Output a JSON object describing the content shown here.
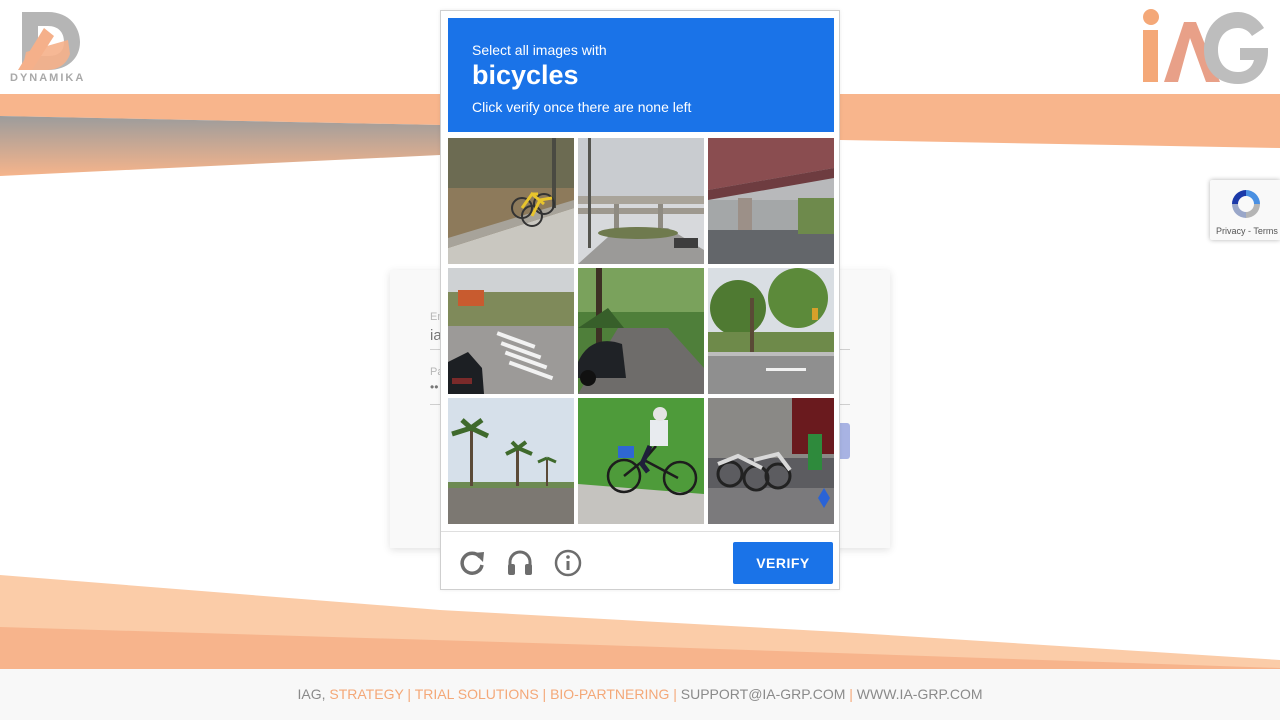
{
  "brand": {
    "left_logo_text": "DYNAMIKA",
    "right_logo_text": "iAG",
    "accent_color": "#f4a878",
    "logo_grey": "#b5b5b5"
  },
  "login": {
    "email_label": "Em",
    "email_value": "ia",
    "password_label": "Pa",
    "password_value": "••"
  },
  "challenge": {
    "line1": "Select all images with",
    "keyword": "bicycles",
    "line3": "Click verify once there are none left",
    "header_color": "#1a73e8",
    "tiles": [
      {
        "icon": "bicycles-on-sidewalk"
      },
      {
        "icon": "highway-overpass"
      },
      {
        "icon": "bridge-underside"
      },
      {
        "icon": "crosswalk-with-car"
      },
      {
        "icon": "street-with-trees"
      },
      {
        "icon": "road-intersection"
      },
      {
        "icon": "palm-tree-street"
      },
      {
        "icon": "person-riding-bicycle"
      },
      {
        "icon": "bike-share-rack"
      }
    ],
    "reload_icon": "reload-icon",
    "audio_icon": "headphones-icon",
    "info_icon": "info-icon",
    "verify_label": "VERIFY"
  },
  "recaptcha_badge": {
    "text": "Privacy - Terms"
  },
  "footer": {
    "prefix": "IAG, ",
    "strategy": "STRATEGY | TRIAL SOLUTIONS | BIO-PARTNERING |",
    "email": " SUPPORT@IA-GRP.COM ",
    "sep": "|",
    "website": " WWW.IA-GRP.COM"
  }
}
